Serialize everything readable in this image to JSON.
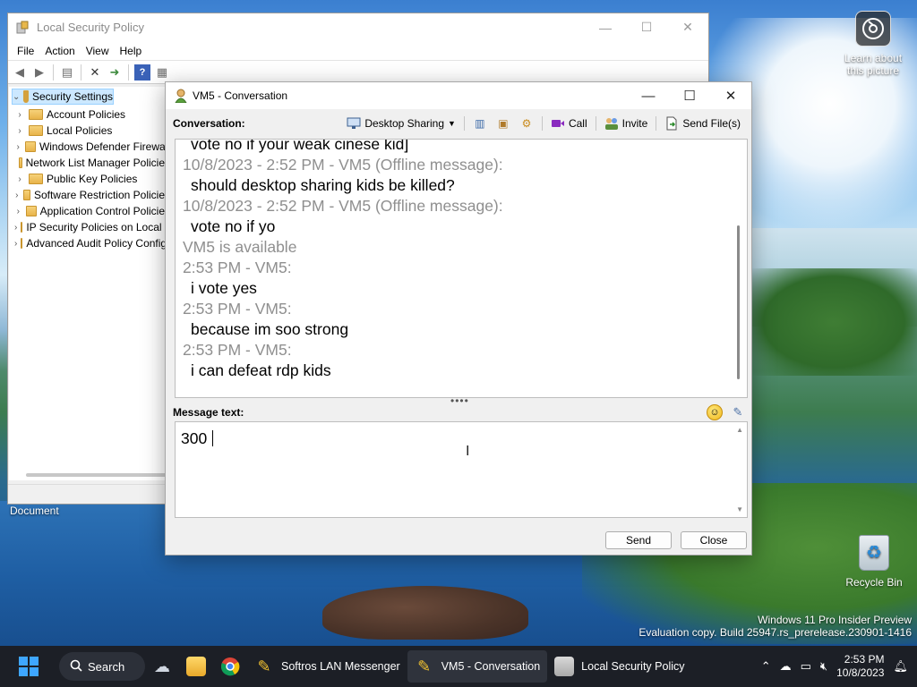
{
  "desktop": {
    "learn_label": "Learn about this picture",
    "recycle_label": "Recycle Bin",
    "document_label": "Document",
    "watermark_line1": "Windows 11 Pro Insider Preview",
    "watermark_line2": "Evaluation copy. Build 25947.rs_prerelease.230901-1416"
  },
  "lsp": {
    "title": "Local Security Policy",
    "menu": [
      "File",
      "Action",
      "View",
      "Help"
    ],
    "tree": {
      "root": "Security Settings",
      "items": [
        {
          "label": "Account Policies",
          "expandable": true
        },
        {
          "label": "Local Policies",
          "expandable": true
        },
        {
          "label": "Windows Defender Firewall",
          "expandable": true
        },
        {
          "label": "Network List Manager Policies",
          "expandable": false
        },
        {
          "label": "Public Key Policies",
          "expandable": true
        },
        {
          "label": "Software Restriction Policies",
          "expandable": true
        },
        {
          "label": "Application Control Policies",
          "expandable": true
        },
        {
          "label": "IP Security Policies on Local Computer",
          "expandable": true
        },
        {
          "label": "Advanced Audit Policy Configuration",
          "expandable": true
        }
      ]
    }
  },
  "conv": {
    "title": "VM5 - Conversation",
    "conversation_label": "Conversation:",
    "tools": {
      "desktop_sharing": "Desktop Sharing",
      "call": "Call",
      "invite": "Invite",
      "send_files": "Send File(s)"
    },
    "log": [
      {
        "kind": "msg",
        "text": "vote no if your weak cinese kid]"
      },
      {
        "kind": "meta",
        "text": "10/8/2023 - 2:52 PM - VM5 (Offline message):"
      },
      {
        "kind": "msg",
        "text": "should desktop sharing kids be killed?"
      },
      {
        "kind": "meta",
        "text": "10/8/2023 - 2:52 PM - VM5 (Offline message):"
      },
      {
        "kind": "msg",
        "text": "vote no if yo"
      },
      {
        "kind": "meta",
        "text": "VM5 is available"
      },
      {
        "kind": "meta",
        "text": "2:53 PM - VM5:"
      },
      {
        "kind": "msg",
        "text": "i vote yes"
      },
      {
        "kind": "meta",
        "text": "2:53 PM - VM5:"
      },
      {
        "kind": "msg",
        "text": "because im soo strong"
      },
      {
        "kind": "meta",
        "text": "2:53 PM - VM5:"
      },
      {
        "kind": "msg",
        "text": "i can defeat rdp kids"
      }
    ],
    "message_label": "Message text:",
    "message_value": "300",
    "send_label": "Send",
    "close_label": "Close"
  },
  "taskbar": {
    "search_label": "Search",
    "apps": [
      {
        "label": "Softros LAN Messenger",
        "icon": "messenger-icon"
      },
      {
        "label": "VM5 - Conversation",
        "icon": "messenger-icon",
        "active": true
      },
      {
        "label": "Local Security Policy",
        "icon": "security-policy-icon"
      }
    ],
    "time": "2:53 PM",
    "date": "10/8/2023"
  },
  "colors": {
    "meta_text": "#8f8f8f",
    "accent": "#3ea6ff",
    "taskbar": "#1c1f26"
  }
}
